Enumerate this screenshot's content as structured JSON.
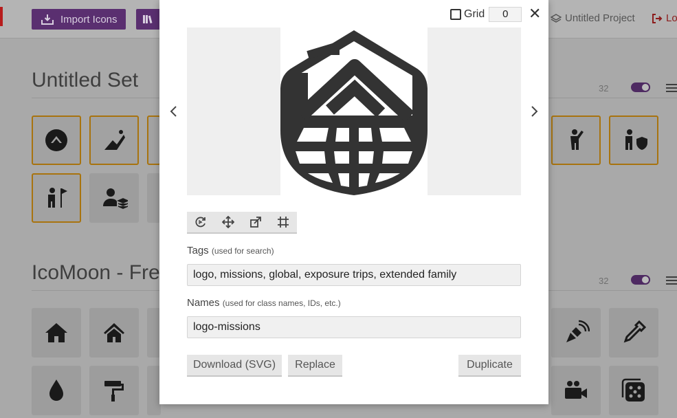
{
  "toolbar": {
    "import_label": "Import Icons",
    "project_label": "Untitled Project",
    "logout_label": "Lo"
  },
  "sets": [
    {
      "title": "Untitled Set",
      "count": "32"
    },
    {
      "title": "IcoMoon - Fre",
      "count": "32"
    }
  ],
  "modal": {
    "grid_label": "Grid",
    "grid_value": "0",
    "close_label": "✕",
    "tags_label": "Tags",
    "tags_hint": "(used for search)",
    "tags_value": "logo, missions, global, exposure trips, extended family",
    "names_label": "Names",
    "names_hint": "(used for class names, IDs, etc.)",
    "names_value": "logo-missions",
    "download_label": "Download (SVG)",
    "replace_label": "Replace",
    "duplicate_label": "Duplicate"
  },
  "colors": {
    "accent": "#5a2f70",
    "selected_border": "#a8730e",
    "icon": "#333333"
  },
  "icons": {
    "preview": "logo-missions-icon",
    "tools": [
      "rotate-icon",
      "move-icon",
      "resize-icon",
      "crop-grid-icon"
    ]
  }
}
